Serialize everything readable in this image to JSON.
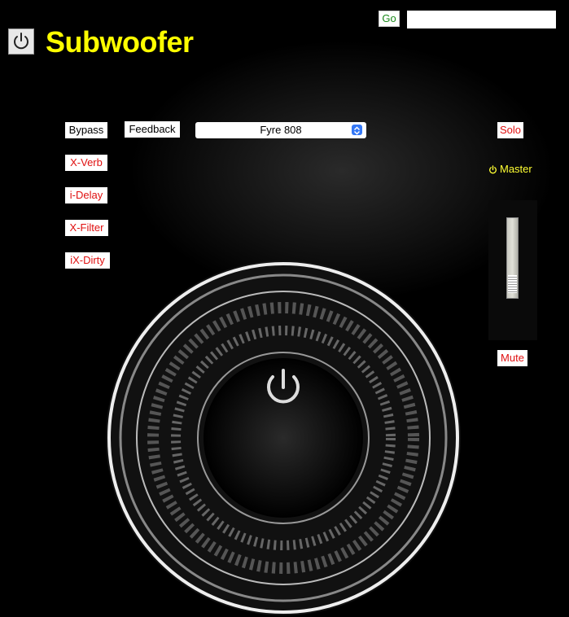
{
  "app": {
    "title": "Subwoofer"
  },
  "toolbar": {
    "go_label": "Go",
    "url_value": ""
  },
  "effects": {
    "bypass": "Bypass",
    "feedback": "Feedback",
    "xverb": "X-Verb",
    "idelay": "i-Delay",
    "xfilter": "X-Filter",
    "ixdirty": "iX-Dirty"
  },
  "preset": {
    "selected": "Fyre 808"
  },
  "channel": {
    "solo": "Solo",
    "master": "Master",
    "mute": "Mute"
  },
  "colors": {
    "accent_yellow": "#ffff00",
    "red_label": "#e01010",
    "go_green": "#1a8a1a",
    "select_arrow": "#3478f6"
  },
  "icons": [
    "power-icon",
    "updown-arrows-icon",
    "master-power-icon",
    "speaker-power-icon"
  ]
}
